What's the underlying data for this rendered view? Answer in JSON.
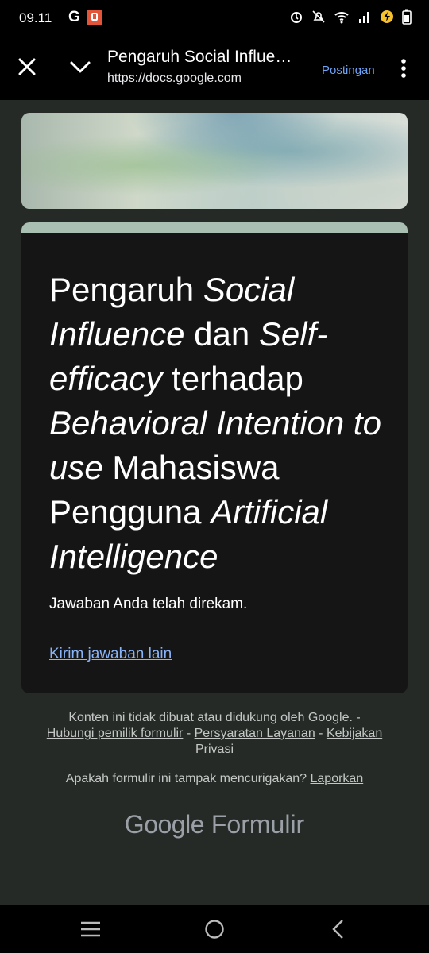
{
  "status_bar": {
    "time": "09.11",
    "left_icons": [
      "g-icon",
      "shop-icon"
    ],
    "right_icons": [
      "alarm-icon",
      "mute-icon",
      "wifi-icon",
      "signal-icon",
      "charging-icon",
      "battery-icon"
    ]
  },
  "toolbar": {
    "title": "Pengaruh Social Influe…",
    "url": "https://docs.google.com",
    "action_label": "Postingan"
  },
  "form": {
    "title_parts": [
      {
        "text": "Pengaruh ",
        "italic": false
      },
      {
        "text": "Social Influence",
        "italic": true
      },
      {
        "text": " dan ",
        "italic": false
      },
      {
        "text": "Self-efficacy",
        "italic": true
      },
      {
        "text": " terhadap ",
        "italic": false
      },
      {
        "text": "Behavioral Intention to use",
        "italic": true
      },
      {
        "text": " Mahasiswa Pengguna ",
        "italic": false
      },
      {
        "text": "Artificial Intelligence",
        "italic": true
      }
    ],
    "confirmation": "Jawaban Anda telah direkam.",
    "submit_another": "Kirim jawaban lain"
  },
  "footer": {
    "disclaimer": "Konten ini tidak dibuat atau didukung oleh Google. -",
    "contact_owner": "Hubungi pemilik formulir",
    "sep1": " - ",
    "terms": "Persyaratan Layanan",
    "sep2": " - ",
    "privacy": "Kebijakan Privasi",
    "suspicious": "Apakah formulir ini tampak mencurigakan?",
    "report": "Laporkan",
    "logo_google": "Google",
    "logo_product": "Formulir"
  },
  "colors": {
    "background": "#252a27",
    "card": "#151515",
    "card_accent": "#a9bfb2",
    "link": "#8ab4f8"
  }
}
